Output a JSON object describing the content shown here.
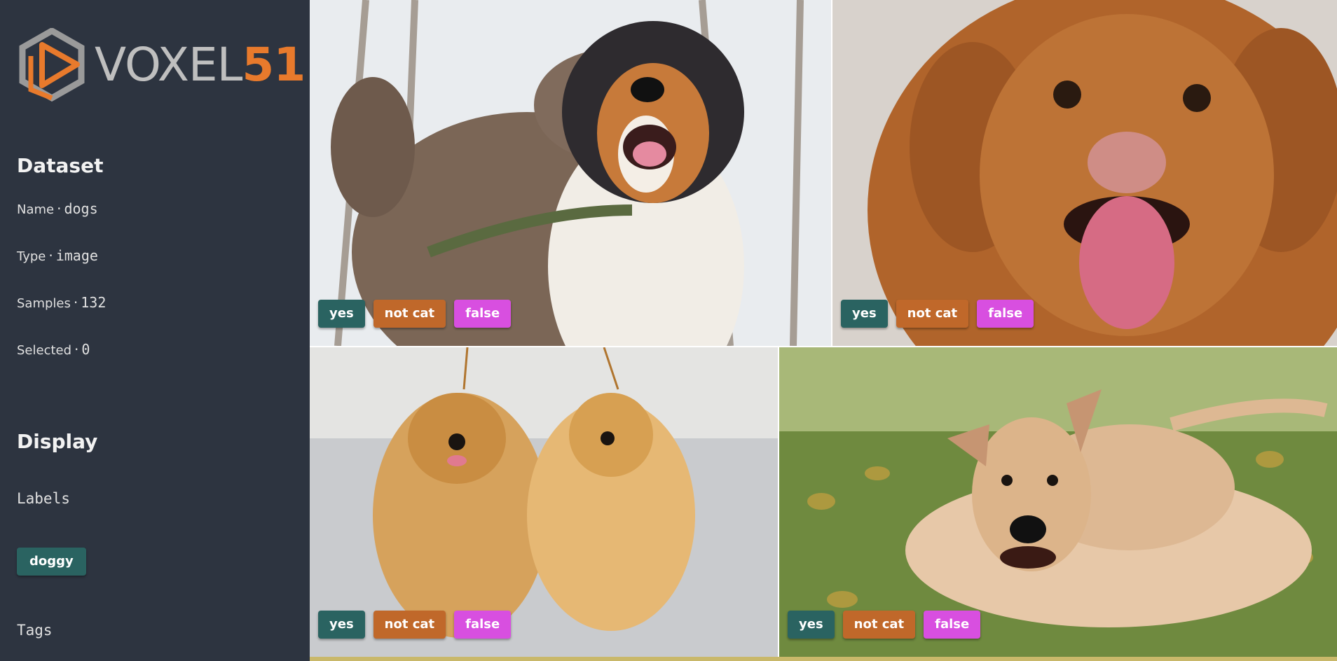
{
  "brand": {
    "word": "VOXEL",
    "num": "51",
    "accent": "#e87a2c"
  },
  "dataset": {
    "title": "Dataset",
    "name_label": "Name",
    "name_value": "dogs",
    "type_label": "Type",
    "type_value": "image",
    "samples_label": "Samples",
    "samples_value": "132",
    "selected_label": "Selected",
    "selected_value": "0",
    "separator": "·"
  },
  "display": {
    "title": "Display",
    "labels_heading": "Labels",
    "label_chip": "doggy",
    "tags_heading": "Tags"
  },
  "badges": {
    "yes": "yes",
    "not_cat": "not cat",
    "false": "false"
  },
  "colors": {
    "yes": "#2a6361",
    "not_cat": "#c0682a",
    "false": "#d84fe0",
    "sidebar": "#2d3440"
  },
  "tiles": [
    {
      "subject": "weimaraner and australian shepherd"
    },
    {
      "subject": "nova scotia duck tolling retriever puppy"
    },
    {
      "subject": "two pomeranians"
    },
    {
      "subject": "tan pit bull puppy on grass"
    }
  ]
}
